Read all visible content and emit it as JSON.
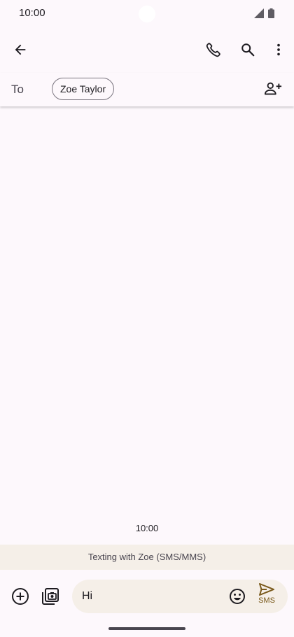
{
  "status_bar": {
    "time": "10:00"
  },
  "app_bar": {
    "back_icon": "arrow-left-icon",
    "call_icon": "phone-icon",
    "search_icon": "search-icon",
    "more_icon": "more-vert-icon"
  },
  "recipients": {
    "to_label": "To",
    "chips": [
      "Zoe Taylor"
    ],
    "add_icon": "add-person-icon"
  },
  "conversation": {
    "timestamp": "10:00",
    "texting_banner": "Texting with Zoe (SMS/MMS)"
  },
  "compose": {
    "message_value": "Hi",
    "send_label": "SMS",
    "add_icon": "add-circle-icon",
    "gallery_icon": "photo-camera-icon",
    "emoji_icon": "emoji-icon",
    "send_icon": "send-icon"
  },
  "colors": {
    "background": "#fdf8fc",
    "banner": "#f5efe8",
    "accent": "#7a5a1c"
  }
}
